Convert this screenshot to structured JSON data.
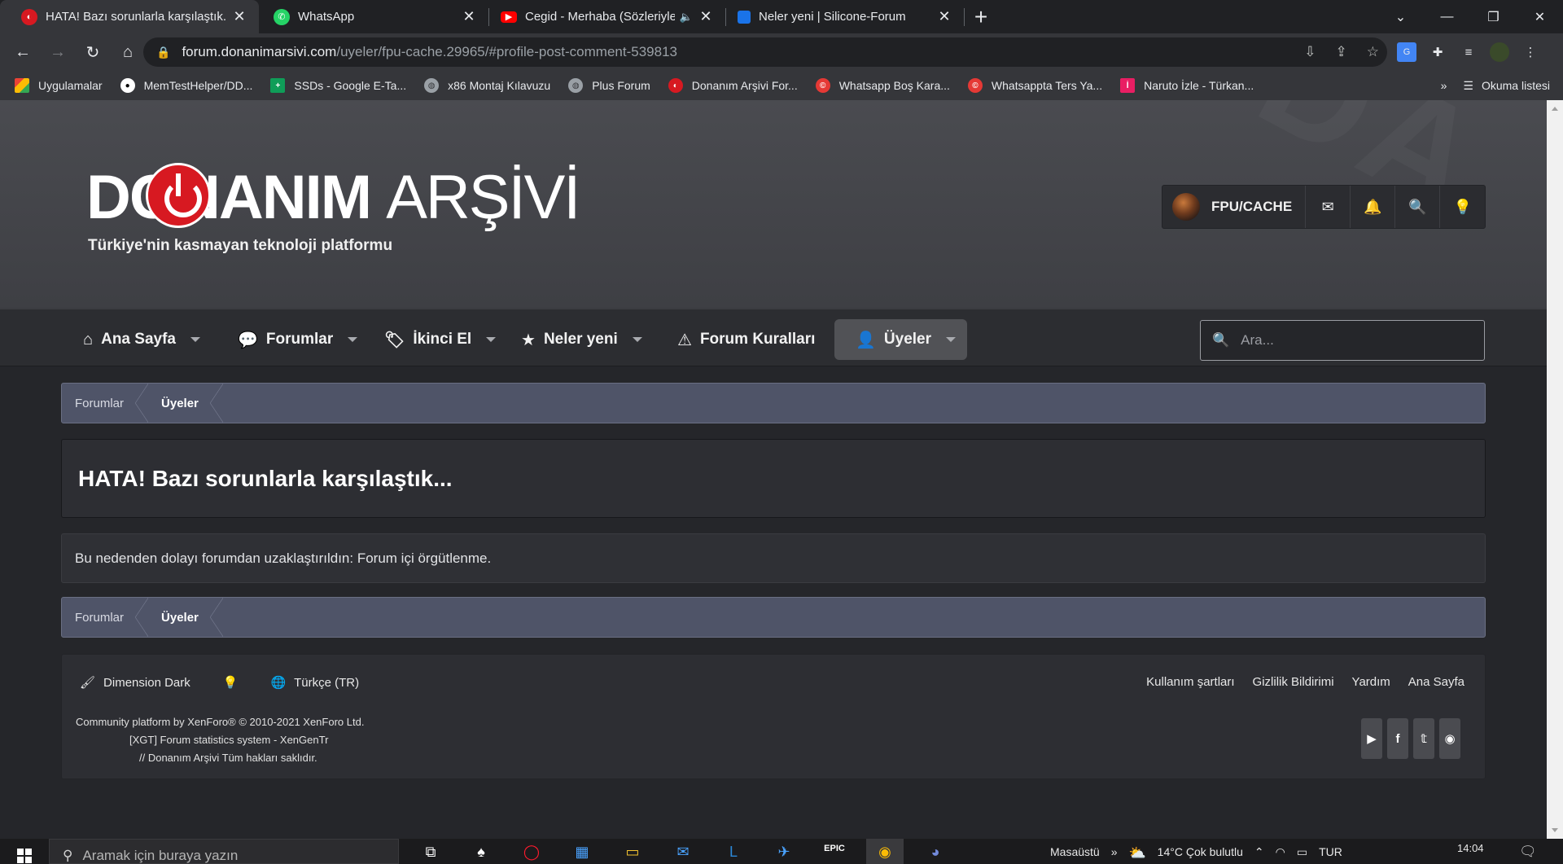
{
  "browser": {
    "tabs": [
      {
        "title": "HATA! Bazı sorunlarla karşılaştık...",
        "favicon_color": "#d71921",
        "active": true
      },
      {
        "title": "WhatsApp",
        "favicon_color": "#25d366",
        "active": false
      },
      {
        "title": "Cegid - Merhaba (Sözleriyle)",
        "favicon_color": "#ff0000",
        "active": false
      },
      {
        "title": "Neler yeni | Silicone-Forum",
        "favicon_color": "#1a73e8",
        "active": false
      }
    ],
    "url_host": "forum.donanimarsivi.com",
    "url_path": "/uyeler/fpu-cache.29965/#profile-post-comment-539813",
    "bookmarks": [
      {
        "label": "Uygulamalar",
        "icon": "apps-grid-icon",
        "color": "#ea4335"
      },
      {
        "label": "MemTestHelper/DD...",
        "icon": "github-icon",
        "color": "#ffffff"
      },
      {
        "label": "SSDs - Google E-Ta...",
        "icon": "sheets-icon",
        "color": "#0f9d58"
      },
      {
        "label": "x86 Montaj Kılavuzu",
        "icon": "globe-icon",
        "color": "#9aa0a6"
      },
      {
        "label": "Plus Forum",
        "icon": "globe-icon",
        "color": "#9aa0a6"
      },
      {
        "label": "Donanım Arşivi For...",
        "icon": "da-icon",
        "color": "#d71921"
      },
      {
        "label": "Whatsapp Boş Kara...",
        "icon": "site-icon",
        "color": "#e53935"
      },
      {
        "label": "Whatsappta Ters Ya...",
        "icon": "site-icon",
        "color": "#e53935"
      },
      {
        "label": "Naruto İzle - Türkan...",
        "icon": "site-icon",
        "color": "#e91e63"
      }
    ],
    "reading_list": "Okuma listesi",
    "more_bookmarks": "»"
  },
  "site": {
    "logo_text_bold": "DONANIM",
    "logo_text_thin": "ARŞİVİ",
    "logo_subtitle": "Türkiye'nin kasmayan teknoloji platformu",
    "username": "FPU/CACHE",
    "nav": [
      {
        "label": "Ana Sayfa",
        "icon": "home-icon",
        "has_caret": true,
        "selected": false
      },
      {
        "label": "Forumlar",
        "icon": "comments-icon",
        "has_caret": true,
        "selected": false
      },
      {
        "label": "İkinci El",
        "icon": "tag-icon",
        "has_caret": true,
        "selected": false
      },
      {
        "label": "Neler yeni",
        "icon": "star-icon",
        "has_caret": true,
        "selected": false
      },
      {
        "label": "Forum Kuralları",
        "icon": "warning-icon",
        "has_caret": false,
        "selected": false
      },
      {
        "label": "Üyeler",
        "icon": "user-icon",
        "has_caret": true,
        "selected": true
      }
    ],
    "search_placeholder": "Ara...",
    "breadcrumb": [
      "Forumlar",
      "Üyeler"
    ],
    "error_title": "HATA! Bazı sorunlarla karşılaştık...",
    "error_message": "Bu nedenden dolayı forumdan uzaklaştırıldın: Forum içi örgütlenme.",
    "footer": {
      "style_name": "Dimension Dark",
      "language": "Türkçe (TR)",
      "links": [
        "Kullanım şartları",
        "Gizlilik Bildirimi",
        "Yardım",
        "Ana Sayfa"
      ],
      "copyright_1": "Community platform by XenForo® © 2010-2021 XenForo Ltd.",
      "copyright_2": "[XGT] Forum statistics system - XenGenTr",
      "copyright_3": "//   Donanım Arşivi Tüm hakları saklıdır.",
      "social": [
        "youtube-icon",
        "facebook-icon",
        "twitter-icon",
        "discord-icon"
      ]
    }
  },
  "taskbar": {
    "search_placeholder": "Aramak için buraya yazın",
    "desktop_label": "Masaüstü",
    "weather": "14°C  Çok bulutlu",
    "language": "TUR",
    "time": "14:04"
  }
}
